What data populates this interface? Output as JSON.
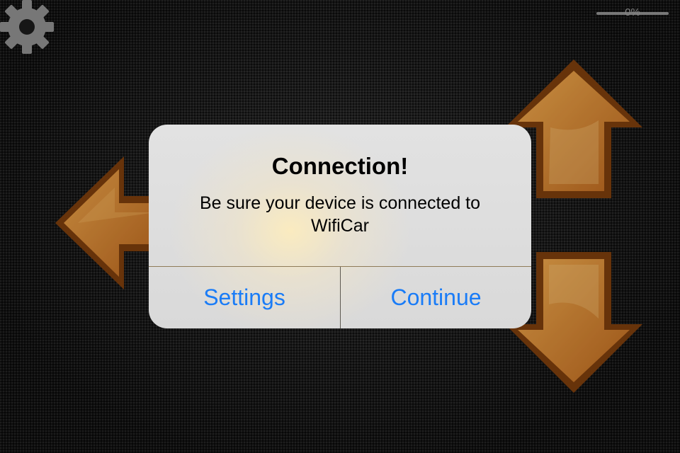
{
  "toolbar": {
    "settings_icon": "gear-icon"
  },
  "progress": {
    "value": 0,
    "label": "0%",
    "track_color": "#8e8e8e"
  },
  "controls": {
    "left_arrow": "arrow-left-icon",
    "up_arrow": "arrow-up-icon",
    "down_arrow": "arrow-down-icon",
    "arrow_color": "#d4862c"
  },
  "alert": {
    "title": "Connection!",
    "message": "Be sure your device is connected to WifiCar",
    "buttons": [
      {
        "label": "Settings"
      },
      {
        "label": "Continue"
      }
    ],
    "button_color": "#1a7cf7"
  }
}
